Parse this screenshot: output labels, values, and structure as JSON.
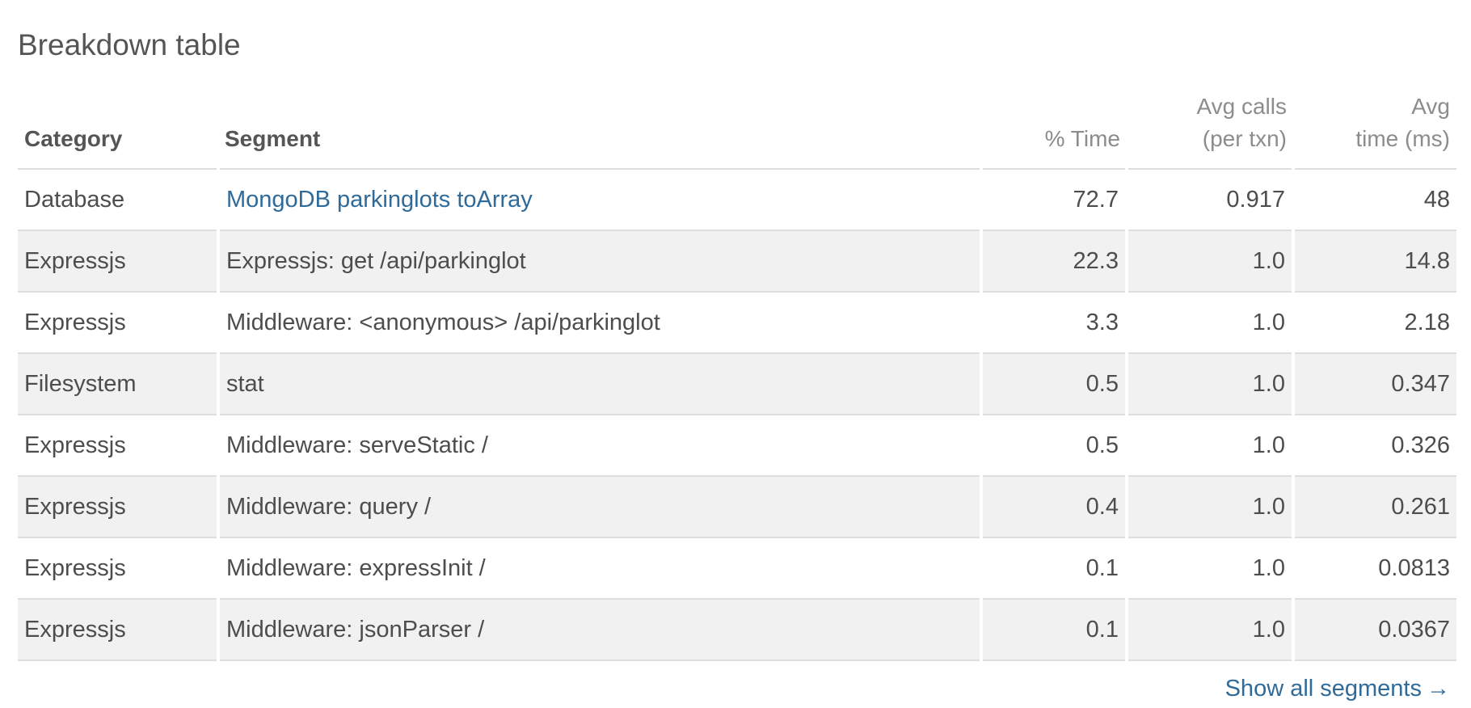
{
  "title": "Breakdown table",
  "columns": {
    "category": "Category",
    "segment": "Segment",
    "pct_time": "% Time",
    "avg_calls_line1": "Avg calls",
    "avg_calls_line2": "(per txn)",
    "avg_time_line1": "Avg",
    "avg_time_line2": "time (ms)"
  },
  "rows": [
    {
      "category": "Database",
      "segment": "MongoDB parkinglots toArray",
      "pct_time": "72.7",
      "avg_calls": "0.917",
      "avg_time": "48",
      "segment_is_link": true
    },
    {
      "category": "Expressjs",
      "segment": "Expressjs: get /api/parkinglot",
      "pct_time": "22.3",
      "avg_calls": "1.0",
      "avg_time": "14.8"
    },
    {
      "category": "Expressjs",
      "segment": "Middleware: <anonymous> /api/parkinglot",
      "pct_time": "3.3",
      "avg_calls": "1.0",
      "avg_time": "2.18"
    },
    {
      "category": "Filesystem",
      "segment": "stat",
      "pct_time": "0.5",
      "avg_calls": "1.0",
      "avg_time": "0.347"
    },
    {
      "category": "Expressjs",
      "segment": "Middleware: serveStatic /",
      "pct_time": "0.5",
      "avg_calls": "1.0",
      "avg_time": "0.326"
    },
    {
      "category": "Expressjs",
      "segment": "Middleware: query /",
      "pct_time": "0.4",
      "avg_calls": "1.0",
      "avg_time": "0.261"
    },
    {
      "category": "Expressjs",
      "segment": "Middleware: expressInit /",
      "pct_time": "0.1",
      "avg_calls": "1.0",
      "avg_time": "0.0813"
    },
    {
      "category": "Expressjs",
      "segment": "Middleware: jsonParser /",
      "pct_time": "0.1",
      "avg_calls": "1.0",
      "avg_time": "0.0367"
    }
  ],
  "footer": {
    "show_all_label": "Show all segments",
    "arrow_glyph": "→"
  },
  "colors": {
    "link": "#2f6b9a",
    "stripe": "#f1f1f1"
  }
}
